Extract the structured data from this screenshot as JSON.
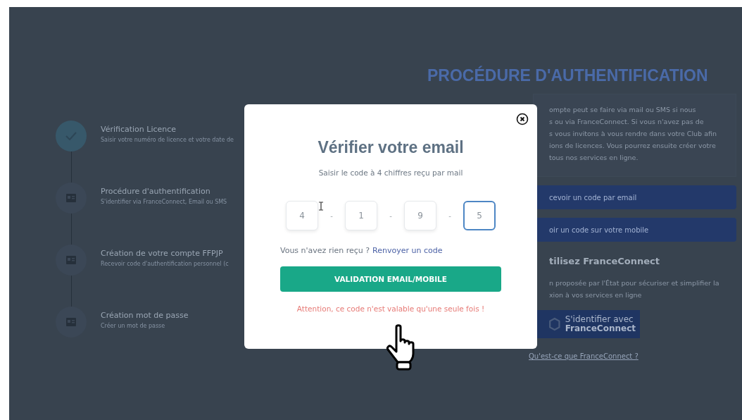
{
  "steps": [
    {
      "title": "Vérification Licence",
      "subtitle": "Saisir votre numéro de licence et votre date de",
      "completed": true
    },
    {
      "title": "Procédure d'authentification",
      "subtitle": "S'identifier via FranceConnect, Email ou SMS",
      "completed": false
    },
    {
      "title": "Création de votre compte FFPJP",
      "subtitle": "Recevoir code d'authentification personnel (c",
      "completed": false
    },
    {
      "title": "Création mot de passe",
      "subtitle": "Créer un mot de passe",
      "completed": false
    }
  ],
  "heading": "PROCÉDURE D'AUTHENTIFICATION",
  "intro_lines": [
    "ompte peut se faire via mail ou SMS si nous",
    "s ou via FranceConnect. Si vous n'avez pas de",
    "s vous invitons à vous rendre dans votre Club afin",
    "ions de licences. Vous pourrez ensuite créer votre",
    "tous nos services en ligne."
  ],
  "option_buttons": [
    "cevoir un code par email",
    "oir un code sur votre mobile"
  ],
  "franceconnect": {
    "title": "tilisez FranceConnect",
    "text_lines": [
      "n proposée par l'État pour sécuriser et simplifier la",
      "xion à vos services en ligne"
    ],
    "button_line_1": "S'identifier avec",
    "button_line_2": "FranceConnect",
    "link": "Qu'est-ce que FranceConnect ?"
  },
  "modal": {
    "title": "Vérifier votre email",
    "subtitle": "Saisir le code à 4 chiffres reçu par mail",
    "code_digits": [
      {
        "value": "4",
        "selected": false
      },
      {
        "value": "1",
        "selected": false
      },
      {
        "value": "9",
        "selected": false
      },
      {
        "value": "5",
        "selected": true
      }
    ],
    "separator": "-",
    "resend_prompt": "Vous n'avez rien reçu ?",
    "resend_link": "Renvoyer un code",
    "submit": "VALIDATION EMAIL/MOBILE",
    "warning": "Attention, ce code n'est valable qu'une seule fois !"
  }
}
